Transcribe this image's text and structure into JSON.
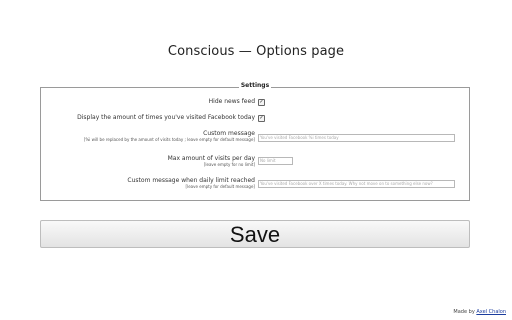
{
  "page": {
    "title": "Conscious — Options page"
  },
  "settings": {
    "legend": "Settings",
    "hide_news_feed": {
      "label": "Hide news feed",
      "checked": true
    },
    "display_visits": {
      "label": "Display the amount of times you've visited Facebook today",
      "checked": true
    },
    "custom_message": {
      "label": "Custom message",
      "hint": "[%i will be replaced by the amount of visits today ; leave empty for default message]",
      "placeholder": "You've visited Facebook %i times today"
    },
    "max_visits": {
      "label": "Max amount of visits per day",
      "hint": "[leave empty for no limit]",
      "placeholder": "No limit"
    },
    "limit_message": {
      "label": "Custom message when daily limit reached",
      "hint": "[leave empty for default message]",
      "placeholder": "You've visited Facebook over X times today. Why not move on to something else now?"
    }
  },
  "save_button": {
    "label": "Save"
  },
  "footer": {
    "made_by": "Made by",
    "author": "Axel Chalon"
  }
}
